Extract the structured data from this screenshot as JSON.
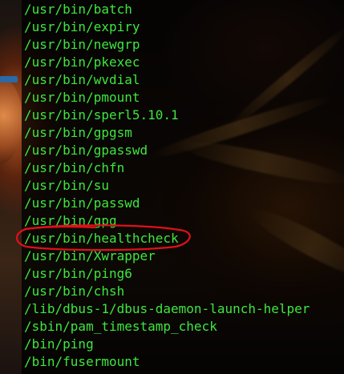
{
  "terminal": {
    "lines": [
      "/usr/bin/batch",
      "/usr/bin/expiry",
      "/usr/bin/newgrp",
      "/usr/bin/pkexec",
      "/usr/bin/wvdial",
      "/usr/bin/pmount",
      "/usr/bin/sperl5.10.1",
      "/usr/bin/gpgsm",
      "/usr/bin/gpasswd",
      "/usr/bin/chfn",
      "/usr/bin/su",
      "/usr/bin/passwd",
      "/usr/bin/gpg",
      "/usr/bin/healthcheck",
      "/usr/bin/Xwrapper",
      "/usr/bin/ping6",
      "/usr/bin/chsh",
      "/lib/dbus-1/dbus-daemon-launch-helper",
      "/sbin/pam_timestamp_check",
      "/bin/ping",
      "/bin/fusermount"
    ],
    "text_color": "#3ee63e",
    "background": "#000000",
    "highlighted_line": "/usr/bin/healthcheck",
    "annotation_color": "#e0101a"
  }
}
